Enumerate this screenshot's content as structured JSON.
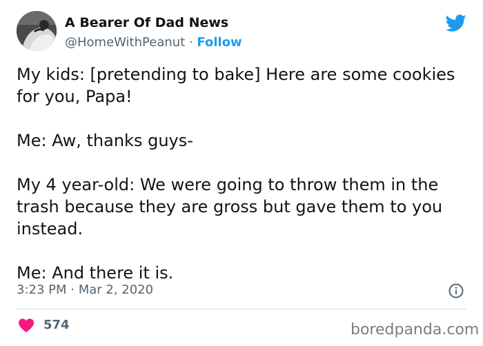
{
  "author": {
    "display_name": "A Bearer Of Dad News",
    "handle": "@HomeWithPeanut",
    "separator": "·",
    "follow_label": "Follow"
  },
  "tweet": {
    "paragraphs": [
      "My kids: [pretending to bake] Here are some cookies for you, Papa!",
      "Me: Aw, thanks guys-",
      "My 4 year-old: We were going to throw them in the trash because they are gross but gave them to you instead.",
      "Me: And there it is."
    ],
    "timestamp": "3:23 PM · Mar 2, 2020",
    "like_count": "574"
  },
  "icons": {
    "brand": "twitter-bird-icon",
    "info": "info-icon",
    "like": "heart-icon"
  },
  "colors": {
    "accent": "#1d9bf0",
    "heart": "#f91880",
    "muted_text": "#536471"
  },
  "watermark": "boredpanda.com"
}
